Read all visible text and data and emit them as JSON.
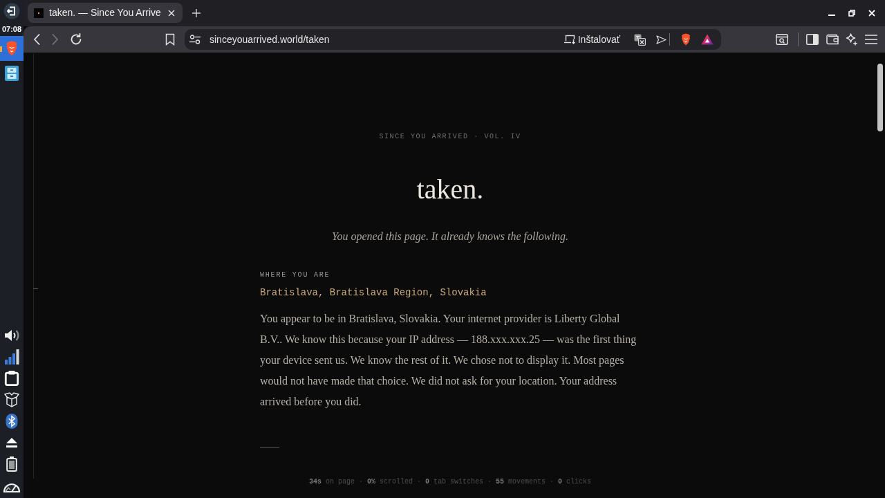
{
  "taskbar": {
    "clock": "07:08",
    "apps": [
      {
        "kind": "browser",
        "active": true
      },
      {
        "kind": "files",
        "active": false
      }
    ]
  },
  "browser": {
    "tabs": [
      {
        "title": "taken. — Since You Arrive",
        "selected": true
      }
    ],
    "nav_buttons": [
      {
        "kind": "back",
        "disabled": false
      },
      {
        "kind": "forward",
        "disabled": true
      },
      {
        "kind": "reload",
        "disabled": false
      }
    ],
    "address_bar": {
      "url": "sinceyouarrived.world/taken",
      "install_label": "Inštalovať"
    }
  },
  "page": {
    "kicker": "SINCE YOU ARRIVED · VOL. IV",
    "title": "taken.",
    "subtitle": "You opened this page. It already knows the following.",
    "sections": [
      {
        "label": "WHERE YOU ARE",
        "value": "Bratislava, Bratislava Region, Slovakia",
        "body": "You appear to be in Bratislava, Slovakia. Your internet provider is Liberty Global B.V.. We know this because your IP address — 188.xxx.xxx.25 — was the first thing your device sent us. We know the rest of it. We chose not to display it. Most pages would not have made that choice. We did not ask for your location. Your address arrived before you did."
      }
    ],
    "stats": "**34s** on page · **0%** scrolled · **0** tab switches · **55** movements · **0** clicks"
  }
}
